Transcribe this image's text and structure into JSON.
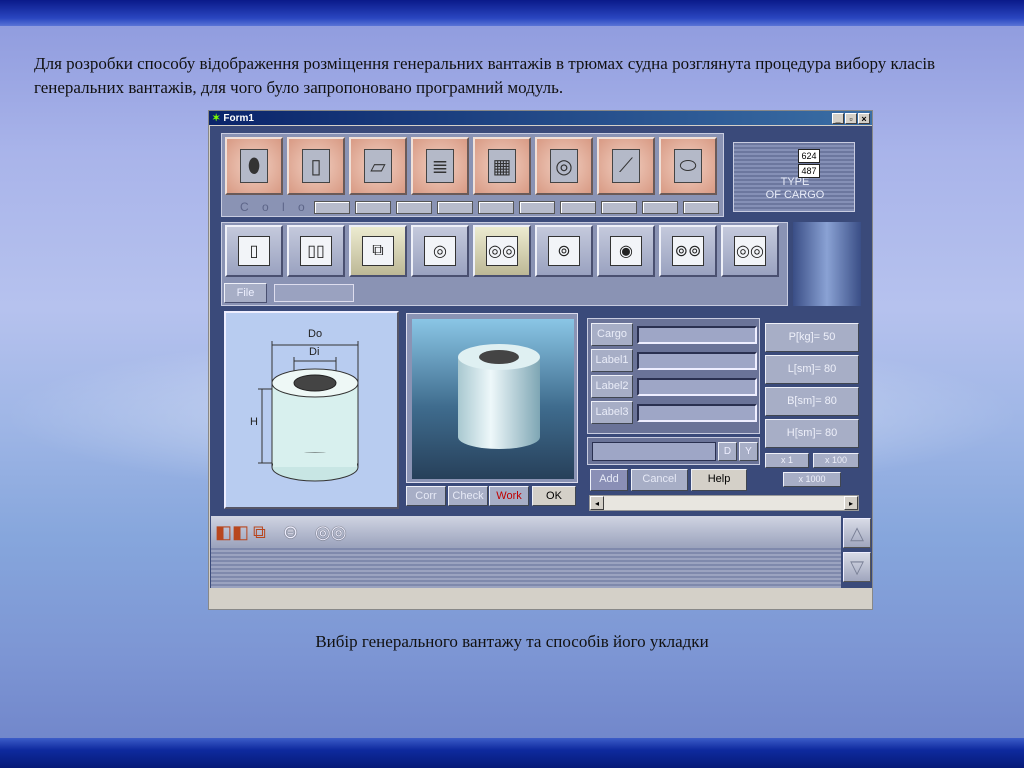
{
  "slide": {
    "intro_text": "Для розробки способу відображення розміщення генеральних вантажів в трюмах судна розглянута процедура вибору класів генеральних вантажів, для чого було запропоновано програмний модуль.",
    "caption": "Вибір генерального вантажу та способів його укладки"
  },
  "window": {
    "title": "Form1",
    "app_icon": "delphi-app-icon",
    "buttons": {
      "minimize": "_",
      "maximize": "▫",
      "close": "×"
    }
  },
  "cargo_types": {
    "items": [
      "barrel",
      "box",
      "sheet",
      "pallet",
      "crate",
      "coil",
      "pipe",
      "roll"
    ],
    "color_label": "C o l o r",
    "swatch_count": 10
  },
  "type_panel": {
    "text_line1": "TYPE",
    "text_line2": "OF CARGO",
    "badge_top": "624",
    "badge_bottom": "487"
  },
  "packing": {
    "items": [
      "single-upright",
      "double-upright",
      "stacked-upright",
      "single-horizontal",
      "triple-horizontal",
      "paired-horizontal",
      "single-horizontal-2",
      "paired-horizontal-2",
      "double-horizontal"
    ],
    "selected": [
      2,
      4
    ],
    "file_label": "File"
  },
  "drawing": {
    "label_do": "Do",
    "label_di": "Di",
    "label_h": "H"
  },
  "actions": {
    "corr": "Corr",
    "check": "Check",
    "work": "Work",
    "ok": "OK"
  },
  "fields": {
    "cargo": "Cargo",
    "label1": "Label1",
    "label2": "Label2",
    "label3": "Label3"
  },
  "dimensions": {
    "p": "P[kg]= 50",
    "l": "L[sm]= 80",
    "b": "B[sm]= 80",
    "h": "H[sm]= 80"
  },
  "multipliers": {
    "x1": "x 1",
    "x100": "x 100",
    "x1000": "x 1000"
  },
  "combo": {
    "d": "D",
    "y": "Y"
  },
  "bottom_buttons": {
    "add": "Add",
    "cancel": "Cancel",
    "help": "Help"
  },
  "toolbar": {
    "items": [
      "boxes-icon",
      "stacked-boxes-icon",
      "cylinders-icon",
      "rolls-icon"
    ]
  },
  "colors": {
    "accent": "#3a4a7a",
    "work_text": "#c00000"
  }
}
